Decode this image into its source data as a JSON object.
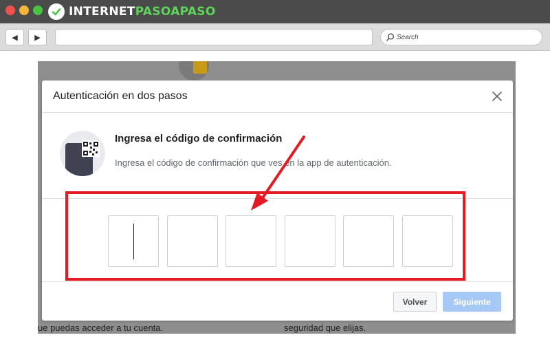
{
  "browser": {
    "logo_prefix": "INTERNET",
    "logo_highlight": "PASOAPASO",
    "search_placeholder": "Search",
    "back_icon": "triangle-left",
    "forward_icon": "triangle-right"
  },
  "background_page": {
    "text_left": "ue puedas acceder a tu cuenta.",
    "text_right": "seguridad que elijas."
  },
  "modal": {
    "title": "Autenticación en dos pasos",
    "heading": "Ingresa el código de confirmación",
    "description": "Ingresa el código de confirmación que ves en la app de autenticación.",
    "code_digits": [
      "",
      "",
      "",
      "",
      "",
      ""
    ],
    "back_label": "Volver",
    "next_label": "Siguiente"
  },
  "colors": {
    "annotation_red": "#e51b24",
    "disabled_primary": "#a5c8f4",
    "logo_green": "#5fd35a"
  }
}
